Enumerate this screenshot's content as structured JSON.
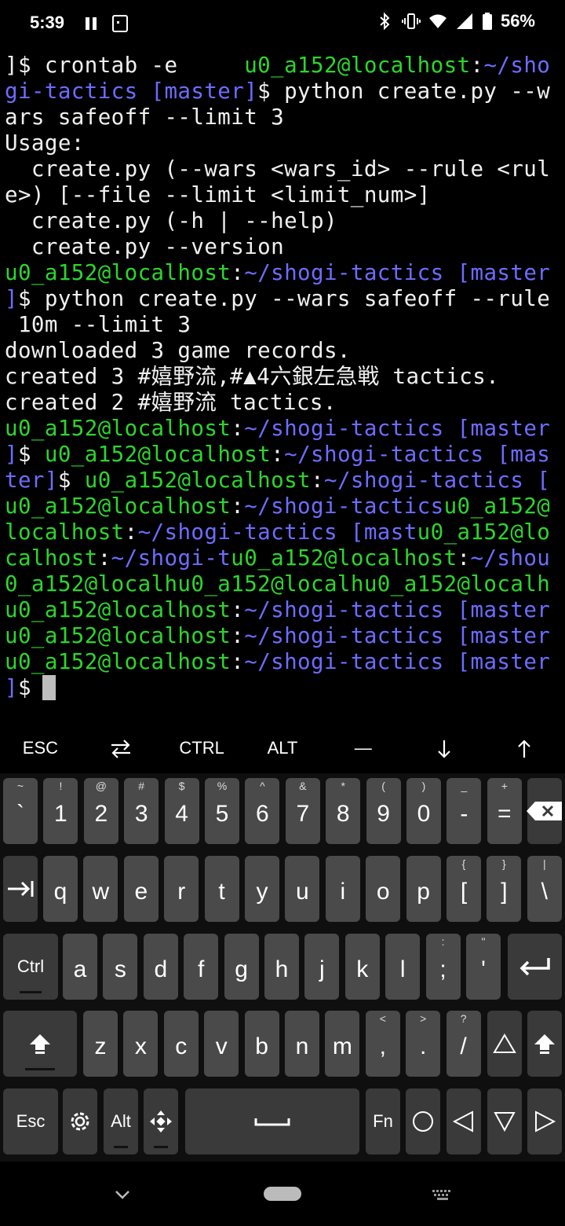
{
  "status_bar": {
    "time": "5:39",
    "battery": "56%"
  },
  "terminal": {
    "lines": [
      [
        [
          "w",
          "]$ crontab -e     "
        ],
        [
          "g",
          "u0_a152@localhost"
        ],
        [
          "w",
          ":"
        ],
        [
          "b",
          "~/sho"
        ]
      ],
      [
        [
          "b",
          "gi-tactics [master]"
        ],
        [
          "w",
          "$ python create.py --w"
        ]
      ],
      [
        [
          "w",
          "ars safeoff --limit 3"
        ]
      ],
      [
        [
          "w",
          "Usage:"
        ]
      ],
      [
        [
          "w",
          "  create.py (--wars <wars_id> --rule <rul"
        ]
      ],
      [
        [
          "w",
          "e>) [--file --limit <limit_num>]"
        ]
      ],
      [
        [
          "w",
          "  create.py (-h | --help)"
        ]
      ],
      [
        [
          "w",
          "  create.py --version"
        ]
      ],
      [
        [
          "g",
          "u0_a152@localhost"
        ],
        [
          "w",
          ":"
        ],
        [
          "b",
          "~/shogi-tactics [master"
        ]
      ],
      [
        [
          "b",
          "]"
        ],
        [
          "w",
          "$ python create.py --wars safeoff --rule"
        ]
      ],
      [
        [
          "w",
          " 10m --limit 3"
        ]
      ],
      [
        [
          "w",
          "downloaded 3 game records."
        ]
      ],
      [
        [
          "w",
          "created 3 #嬉野流,#▲4六銀左急戦 tactics."
        ]
      ],
      [
        [
          "w",
          "created 2 #嬉野流 tactics."
        ]
      ],
      [
        [
          "g",
          "u0_a152@localhost"
        ],
        [
          "w",
          ":"
        ],
        [
          "b",
          "~/shogi-tactics [master"
        ]
      ],
      [
        [
          "b",
          "]"
        ],
        [
          "w",
          "$ "
        ],
        [
          "g",
          "u0_a152@localhost"
        ],
        [
          "w",
          ":"
        ],
        [
          "b",
          "~/shogi-tactics [mas"
        ]
      ],
      [
        [
          "b",
          "ter]"
        ],
        [
          "w",
          "$ "
        ],
        [
          "g",
          "u0_a152@localhost"
        ],
        [
          "w",
          ":"
        ],
        [
          "b",
          "~/shogi-tactics ["
        ]
      ],
      [
        [
          "g",
          "u0_a152@localhost"
        ],
        [
          "w",
          ":"
        ],
        [
          "b",
          "~/shogi-tactics"
        ],
        [
          "g",
          "u0_a152@"
        ]
      ],
      [
        [
          "g",
          "localhost"
        ],
        [
          "w",
          ":"
        ],
        [
          "b",
          "~/shogi-tactics [mast"
        ],
        [
          "g",
          "u0_a152@lo"
        ]
      ],
      [
        [
          "g",
          "calhost"
        ],
        [
          "w",
          ":"
        ],
        [
          "b",
          "~/shogi-t"
        ],
        [
          "g",
          "u0_a152@localhost"
        ],
        [
          "w",
          ":"
        ],
        [
          "b",
          "~/shou"
        ]
      ],
      [
        [
          "g",
          "0_a152@localhu0_a152@localhu0_a152@localh"
        ]
      ],
      [
        [
          "g",
          "u0_a152@localhost"
        ],
        [
          "w",
          ":"
        ],
        [
          "b",
          "~/shogi-tactics [master"
        ]
      ],
      [
        [
          "g",
          "u0_a152@localhost"
        ],
        [
          "w",
          ":"
        ],
        [
          "b",
          "~/shogi-tactics [master"
        ]
      ],
      [
        [
          "g",
          "u0_a152@localhost"
        ],
        [
          "w",
          ":"
        ],
        [
          "b",
          "~/shogi-tactics [master"
        ]
      ],
      [
        [
          "b",
          "]"
        ],
        [
          "w",
          "$"
        ]
      ]
    ]
  },
  "extra_keys": {
    "esc": "ESC",
    "tab_icon": "swap-arrows-icon",
    "ctrl": "CTRL",
    "alt": "ALT",
    "dash": "—",
    "down_icon": "arrow-down-icon",
    "up_icon": "arrow-up-icon"
  },
  "keyboard": {
    "number_row": [
      {
        "main": "`",
        "sub": "~"
      },
      {
        "main": "1",
        "sub": "!"
      },
      {
        "main": "2",
        "sub": "@"
      },
      {
        "main": "3",
        "sub": "#"
      },
      {
        "main": "4",
        "sub": "$"
      },
      {
        "main": "5",
        "sub": "%"
      },
      {
        "main": "6",
        "sub": "^"
      },
      {
        "main": "7",
        "sub": "&"
      },
      {
        "main": "8",
        "sub": "*"
      },
      {
        "main": "9",
        "sub": "("
      },
      {
        "main": "0",
        "sub": ")"
      },
      {
        "main": "-",
        "sub": "_"
      },
      {
        "main": "=",
        "sub": "+"
      }
    ],
    "qwerty_row": [
      {
        "main": "q",
        "sub": ""
      },
      {
        "main": "w",
        "sub": ""
      },
      {
        "main": "e",
        "sub": ""
      },
      {
        "main": "r",
        "sub": ""
      },
      {
        "main": "t",
        "sub": ""
      },
      {
        "main": "y",
        "sub": ""
      },
      {
        "main": "u",
        "sub": ""
      },
      {
        "main": "i",
        "sub": ""
      },
      {
        "main": "o",
        "sub": ""
      },
      {
        "main": "p",
        "sub": ""
      },
      {
        "main": "[",
        "sub": "{"
      },
      {
        "main": "]",
        "sub": "}"
      },
      {
        "main": "\\",
        "sub": "|"
      }
    ],
    "home_row": [
      {
        "main": "a",
        "sub": ""
      },
      {
        "main": "s",
        "sub": ""
      },
      {
        "main": "d",
        "sub": ""
      },
      {
        "main": "f",
        "sub": ""
      },
      {
        "main": "g",
        "sub": ""
      },
      {
        "main": "h",
        "sub": ""
      },
      {
        "main": "j",
        "sub": ""
      },
      {
        "main": "k",
        "sub": ""
      },
      {
        "main": "l",
        "sub": ""
      },
      {
        "main": ";",
        "sub": ":"
      },
      {
        "main": "'",
        "sub": "\""
      }
    ],
    "bottom_row": [
      {
        "main": "z",
        "sub": ""
      },
      {
        "main": "x",
        "sub": ""
      },
      {
        "main": "c",
        "sub": ""
      },
      {
        "main": "v",
        "sub": ""
      },
      {
        "main": "b",
        "sub": ""
      },
      {
        "main": "n",
        "sub": ""
      },
      {
        "main": "m",
        "sub": ""
      },
      {
        "main": ",",
        "sub": "<"
      },
      {
        "main": ".",
        "sub": ">"
      },
      {
        "main": "/",
        "sub": "?"
      }
    ],
    "ctrl_label": "Ctrl",
    "esc_label": "Esc",
    "alt_label": "Alt",
    "fn_label": "Fn"
  }
}
